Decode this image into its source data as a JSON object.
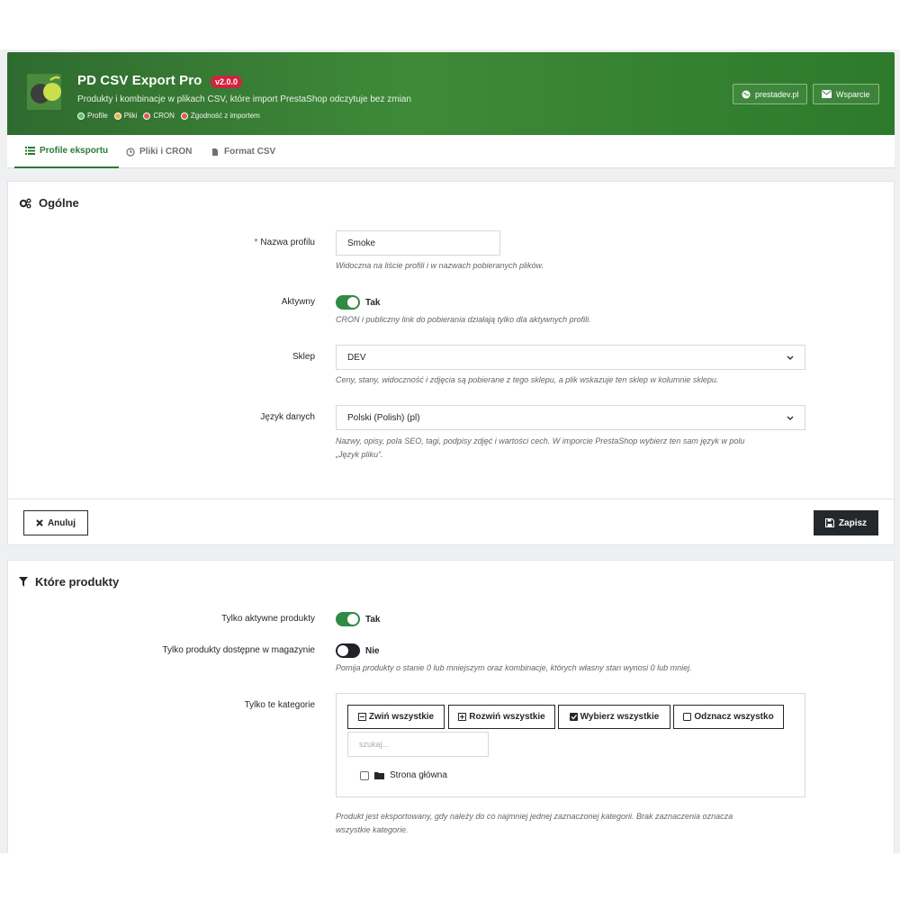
{
  "header": {
    "title": "PD CSV Export Pro",
    "version": "v2.0.0",
    "subtitle": "Produkty i kombinacje w plikach CSV, które import PrestaShop odczytuje bez zmian",
    "chips": [
      {
        "label": "Profile",
        "color": "#5cc26a"
      },
      {
        "label": "Pliki",
        "color": "#e9b13b"
      },
      {
        "label": "CRON",
        "color": "#e05a4a"
      },
      {
        "label": "Zgodność z importem",
        "color": "#e05a4a"
      }
    ],
    "site_button": "prestadev.pl",
    "support_button": "Wsparcie"
  },
  "tabs": [
    {
      "label": "Profile eksportu",
      "icon": "list-icon",
      "active": true
    },
    {
      "label": "Pliki i CRON",
      "icon": "clock-icon",
      "active": false
    },
    {
      "label": "Format CSV",
      "icon": "file-icon",
      "active": false
    }
  ],
  "general": {
    "title": "Ogólne",
    "name": {
      "label": "Nazwa profilu",
      "required_mark": "*",
      "value": "Smoke",
      "help": "Widoczna na liście profili i w nazwach pobieranych plików."
    },
    "active": {
      "label": "Aktywny",
      "state": "Tak",
      "help": "CRON i publiczny link do pobierania działają tylko dla aktywnych profili."
    },
    "shop": {
      "label": "Sklep",
      "value": "DEV",
      "help": "Ceny, stany, widoczność i zdjęcia są pobierane z tego sklepu, a plik wskazuje ten sklep w kolumnie sklepu."
    },
    "language": {
      "label": "Język danych",
      "value": "Polski (Polish) (pl)",
      "help_line1": "Nazwy, opisy, pola SEO, tagi, podpisy zdjęć i wartości cech. W imporcie PrestaShop wybierz ten sam język w polu",
      "help_line2": "„Język pliku”."
    },
    "cancel_label": "Anuluj",
    "save_label": "Zapisz"
  },
  "products": {
    "title": "Które produkty",
    "only_active": {
      "label": "Tylko aktywne produkty",
      "state": "Tak"
    },
    "only_in_stock": {
      "label": "Tylko produkty dostępne w magazynie",
      "state": "Nie",
      "help": "Pomija produkty o stanie 0 lub mniejszym oraz kombinacje, których własny stan wynosi 0 lub mniej."
    },
    "categories": {
      "label": "Tylko te kategorie",
      "collapse_all": "Zwiń wszystkie",
      "expand_all": "Rozwiń wszystkie",
      "select_all": "Wybierz wszystkie",
      "deselect_all": "Odznacz wszystko",
      "search_placeholder": "szukaj...",
      "root": "Strona główna",
      "help_line1": "Produkt jest eksportowany, gdy należy do co najmniej jednej zaznaczonej kategorii. Brak zaznaczenia oznacza",
      "help_line2": "wszystkie kategorie."
    }
  }
}
